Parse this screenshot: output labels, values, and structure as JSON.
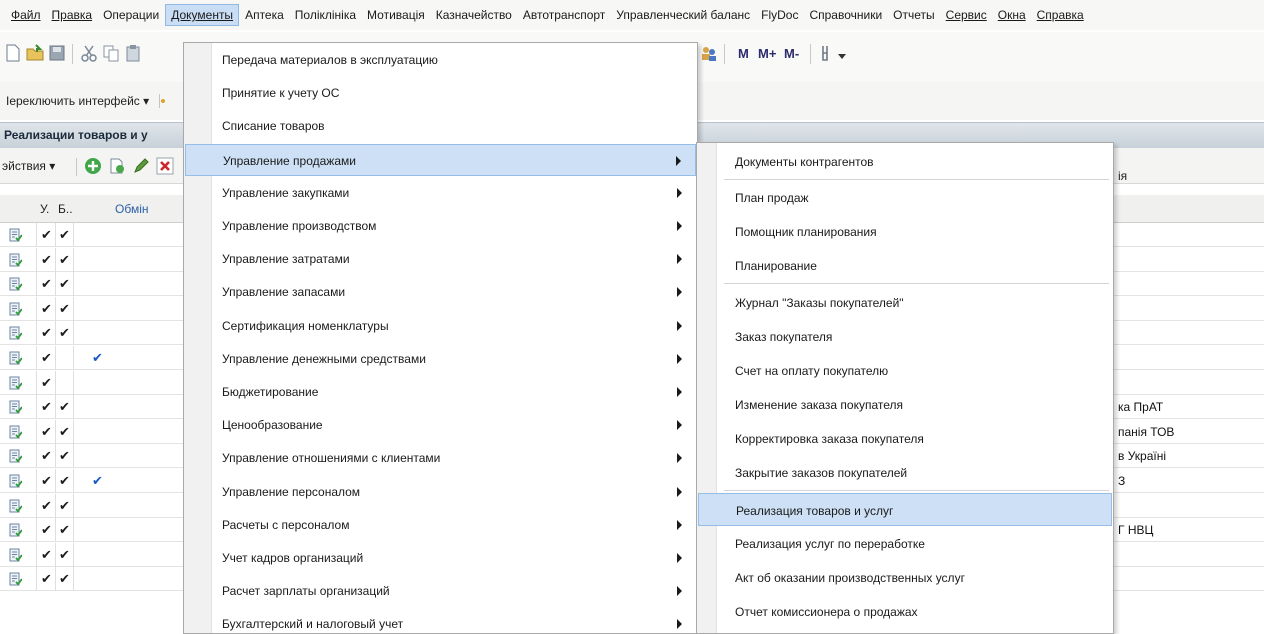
{
  "menubar": {
    "items": [
      "Файл",
      "Правка",
      "Операции",
      "Документы",
      "Аптека",
      "Поліклініка",
      "Мотивація",
      "Казначейство",
      "Автотранспорт",
      "Управленческий баланс",
      "FlyDoc",
      "Справочники",
      "Отчеты",
      "Сервис",
      "Окна",
      "Справка"
    ]
  },
  "toolbar": {
    "memory_buttons": [
      "M",
      "M+",
      "M-"
    ]
  },
  "toolbar2": {
    "switch_interface": "Іереключить интерфейс ▾"
  },
  "panel": {
    "title": "Реализации товаров и у"
  },
  "actions": {
    "label": "эйствия ▾"
  },
  "grid": {
    "headers": [
      "У.",
      "Б..",
      "Обмін",
      "ія"
    ],
    "rows": [
      {
        "u": "✔",
        "b": "✔",
        "o": "",
        "right": ""
      },
      {
        "u": "✔",
        "b": "✔",
        "o": "",
        "right": ""
      },
      {
        "u": "✔",
        "b": "✔",
        "o": "",
        "right": ""
      },
      {
        "u": "✔",
        "b": "✔",
        "o": "",
        "right": ""
      },
      {
        "u": "✔",
        "b": "✔",
        "o": "",
        "right": ""
      },
      {
        "u": "✔",
        "b": "",
        "o": "✔",
        "right": ""
      },
      {
        "u": "✔",
        "b": "",
        "o": "",
        "right": ""
      },
      {
        "u": "✔",
        "b": "✔",
        "o": "",
        "right": "ка ПрАТ"
      },
      {
        "u": "✔",
        "b": "✔",
        "o": "",
        "right": "панія ТОВ"
      },
      {
        "u": "✔",
        "b": "✔",
        "o": "",
        "right": "в Україні"
      },
      {
        "u": "✔",
        "b": "✔",
        "o": "✔",
        "right": "З"
      },
      {
        "u": "✔",
        "b": "✔",
        "o": "",
        "right": ""
      },
      {
        "u": "✔",
        "b": "✔",
        "o": "",
        "right": "Г НВЦ"
      },
      {
        "u": "✔",
        "b": "✔",
        "o": "",
        "right": ""
      },
      {
        "u": "✔",
        "b": "✔",
        "o": "",
        "right": ""
      }
    ]
  },
  "documents_menu": {
    "items": [
      {
        "label": "Передача материалов в эксплуатацию",
        "submenu": false
      },
      {
        "label": "Принятие к учету ОС",
        "submenu": false
      },
      {
        "label": "Списание товаров",
        "submenu": false
      },
      {
        "label": "Управление продажами",
        "submenu": true
      },
      {
        "label": "Управление закупками",
        "submenu": true
      },
      {
        "label": "Управление производством",
        "submenu": true
      },
      {
        "label": "Управление затратами",
        "submenu": true
      },
      {
        "label": "Управление запасами",
        "submenu": true
      },
      {
        "label": "Сертификация номенклатуры",
        "submenu": true
      },
      {
        "label": "Управление денежными средствами",
        "submenu": true
      },
      {
        "label": "Бюджетирование",
        "submenu": true
      },
      {
        "label": "Ценообразование",
        "submenu": true
      },
      {
        "label": "Управление отношениями с клиентами",
        "submenu": true
      },
      {
        "label": "Управление персоналом",
        "submenu": true
      },
      {
        "label": "Расчеты с персоналом",
        "submenu": true
      },
      {
        "label": "Учет кадров организаций",
        "submenu": true
      },
      {
        "label": "Расчет зарплаты организаций",
        "submenu": true
      },
      {
        "label": "Бухгалтерский и налоговый учет",
        "submenu": true
      }
    ]
  },
  "sales_menu": {
    "items": [
      "Документы контрагентов",
      "План продаж",
      "Помощник планирования",
      "Планирование",
      "Журнал \"Заказы покупателей\"",
      "Заказ покупателя",
      "Счет на оплату покупателю",
      "Изменение заказа покупателя",
      "Корректировка заказа покупателя",
      "Закрытие заказов покупателей",
      "Реализация товаров и услуг",
      "Реализация услуг по переработке",
      "Акт об оказании производственных услуг",
      "Отчет комиссионера о продажах"
    ]
  },
  "colors": {
    "highlight": "#cde0f5",
    "highlight_border": "#95bde6",
    "check_blue": "#1b57c4"
  }
}
